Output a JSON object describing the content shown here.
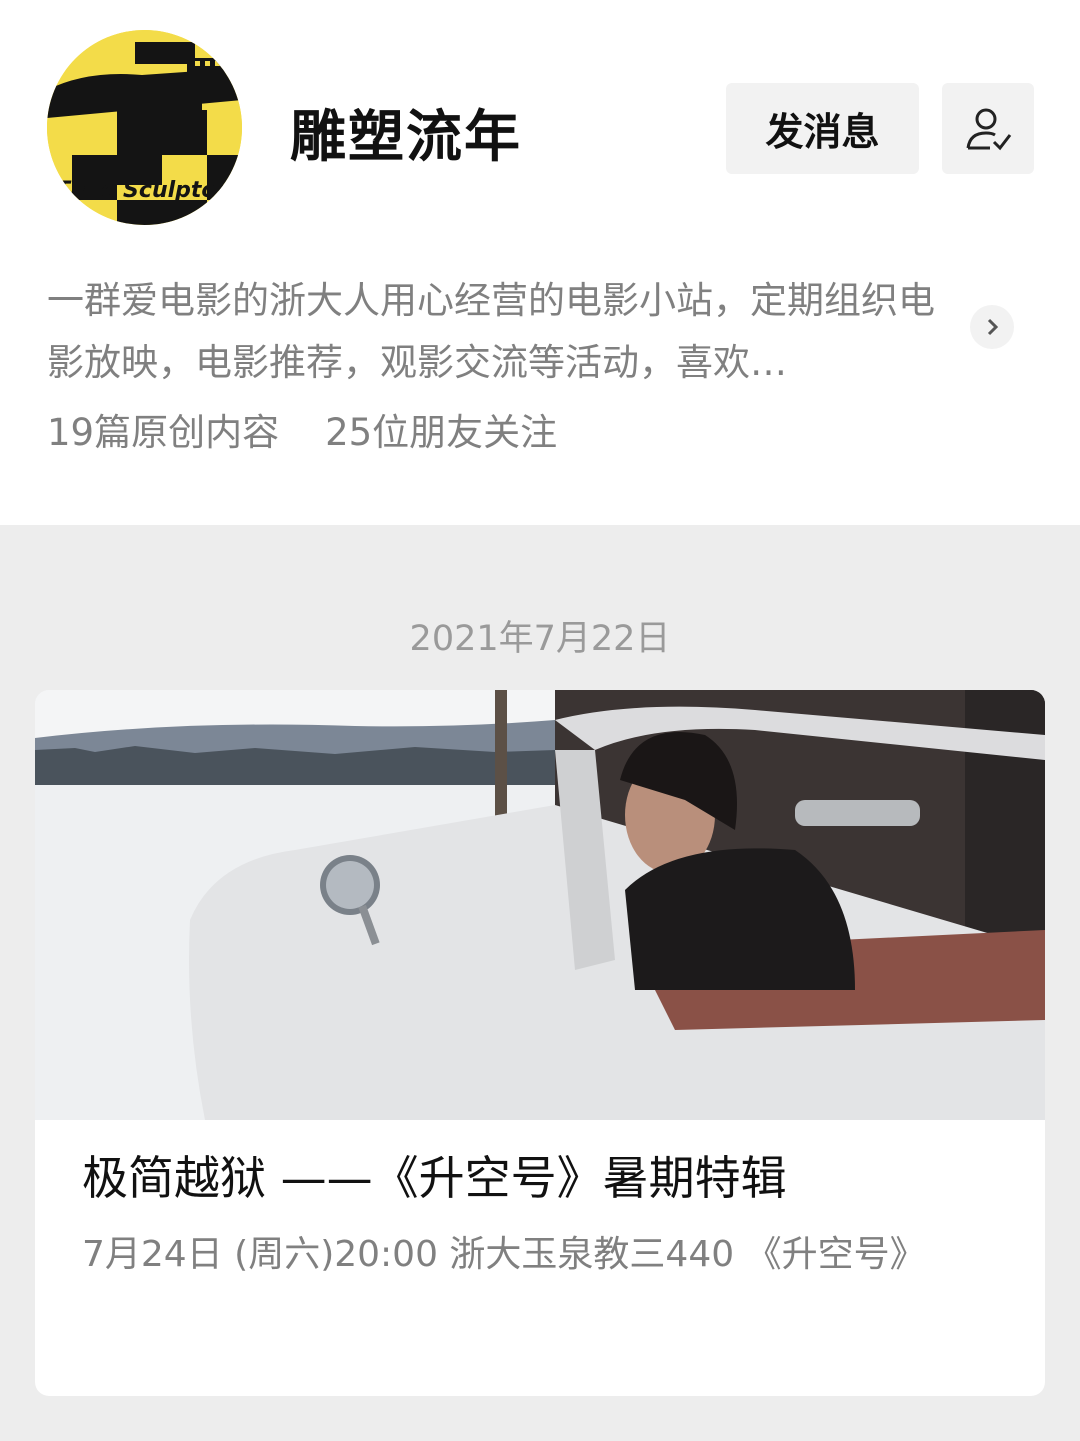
{
  "account": {
    "name": "雕塑流年",
    "avatar_text": "Time Sculptor",
    "send_message_label": "发消息",
    "description": "一群爱电影的浙大人用心经营的电影小站，定期组织电影放映，电影推荐，观影交流等活动，喜欢…",
    "original_count": "19篇原创内容",
    "friends_following": "25位朋友关注"
  },
  "feed": {
    "date": "2021年7月22日",
    "article": {
      "title": "极简越狱 ——《升空号》暑期特辑",
      "subtitle": "7月24日 (周六)20:00 浙大玉泉教三440 《升空号》"
    }
  },
  "colors": {
    "avatar_yellow": "#f3dc49",
    "avatar_black": "#111111",
    "secondary_text": "#808080",
    "page_background": "#ededed"
  },
  "icons": [
    "user-check-icon",
    "chevron-right-icon"
  ]
}
